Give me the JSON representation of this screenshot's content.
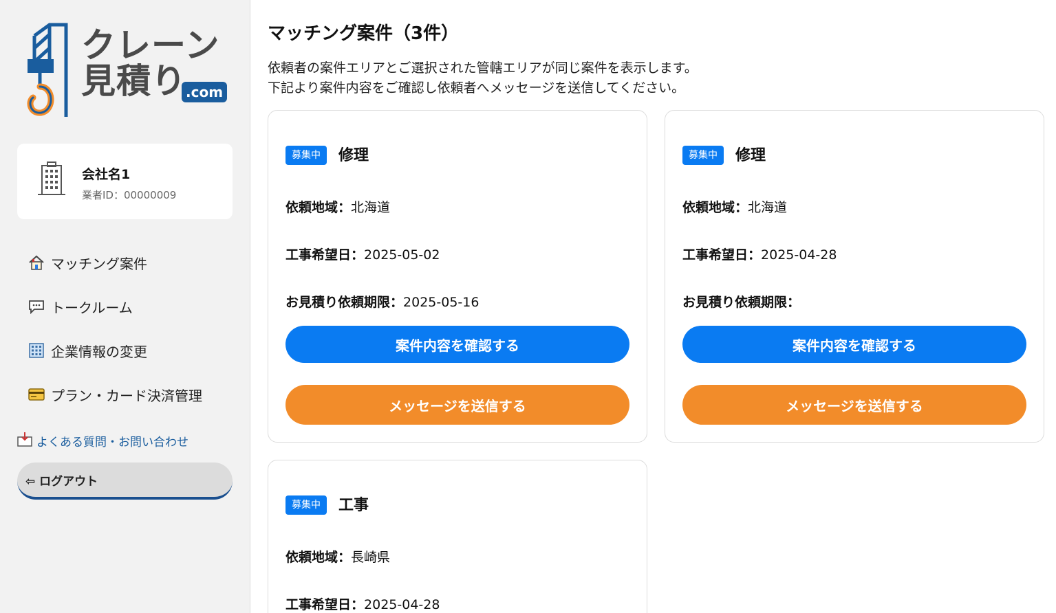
{
  "sidebar": {
    "logo": {
      "text_line1": "クレーン",
      "text_line2": "見積り",
      "domain": ".com"
    },
    "company": {
      "name": "会社名1",
      "id_label": "業者ID：00000009"
    },
    "nav": [
      {
        "label": "マッチング案件",
        "icon": "house-icon"
      },
      {
        "label": "トークルーム",
        "icon": "speech-bubble-icon"
      },
      {
        "label": "企業情報の変更",
        "icon": "office-building-icon"
      },
      {
        "label": "プラン・カード決済管理",
        "icon": "credit-card-icon"
      }
    ],
    "faq_label": "よくある質問・お問い合わせ",
    "logout_label": "⇦ ログアウト"
  },
  "main": {
    "title": "マッチング案件（3件）",
    "desc_line1": "依頼者の案件エリアとご選択された管轄エリアが同じ案件を表示します。",
    "desc_line2": "下記より案件内容をご確認し依頼者へメッセージを送信してください。",
    "labels": {
      "region": "依頼地域：",
      "work_date": "工事希望日：",
      "deadline": "お見積り依頼期限："
    },
    "cards": [
      {
        "badge": "募集中",
        "title": "修理",
        "region": "北海道",
        "work_date": "2025-05-02",
        "deadline": "2025-05-16",
        "confirm_label": "案件内容を確認する",
        "message_label": "メッセージを送信する"
      },
      {
        "badge": "募集中",
        "title": "修理",
        "region": "北海道",
        "work_date": "2025-04-28",
        "deadline": "",
        "confirm_label": "案件内容を確認する",
        "message_label": "メッセージを送信する"
      },
      {
        "badge": "募集中",
        "title": "工事",
        "region": "長崎県",
        "work_date": "2025-04-28"
      }
    ]
  },
  "colors": {
    "accent_blue": "#0a7bf2",
    "accent_orange": "#f28c2a",
    "brand_navy": "#1a5d9e"
  }
}
